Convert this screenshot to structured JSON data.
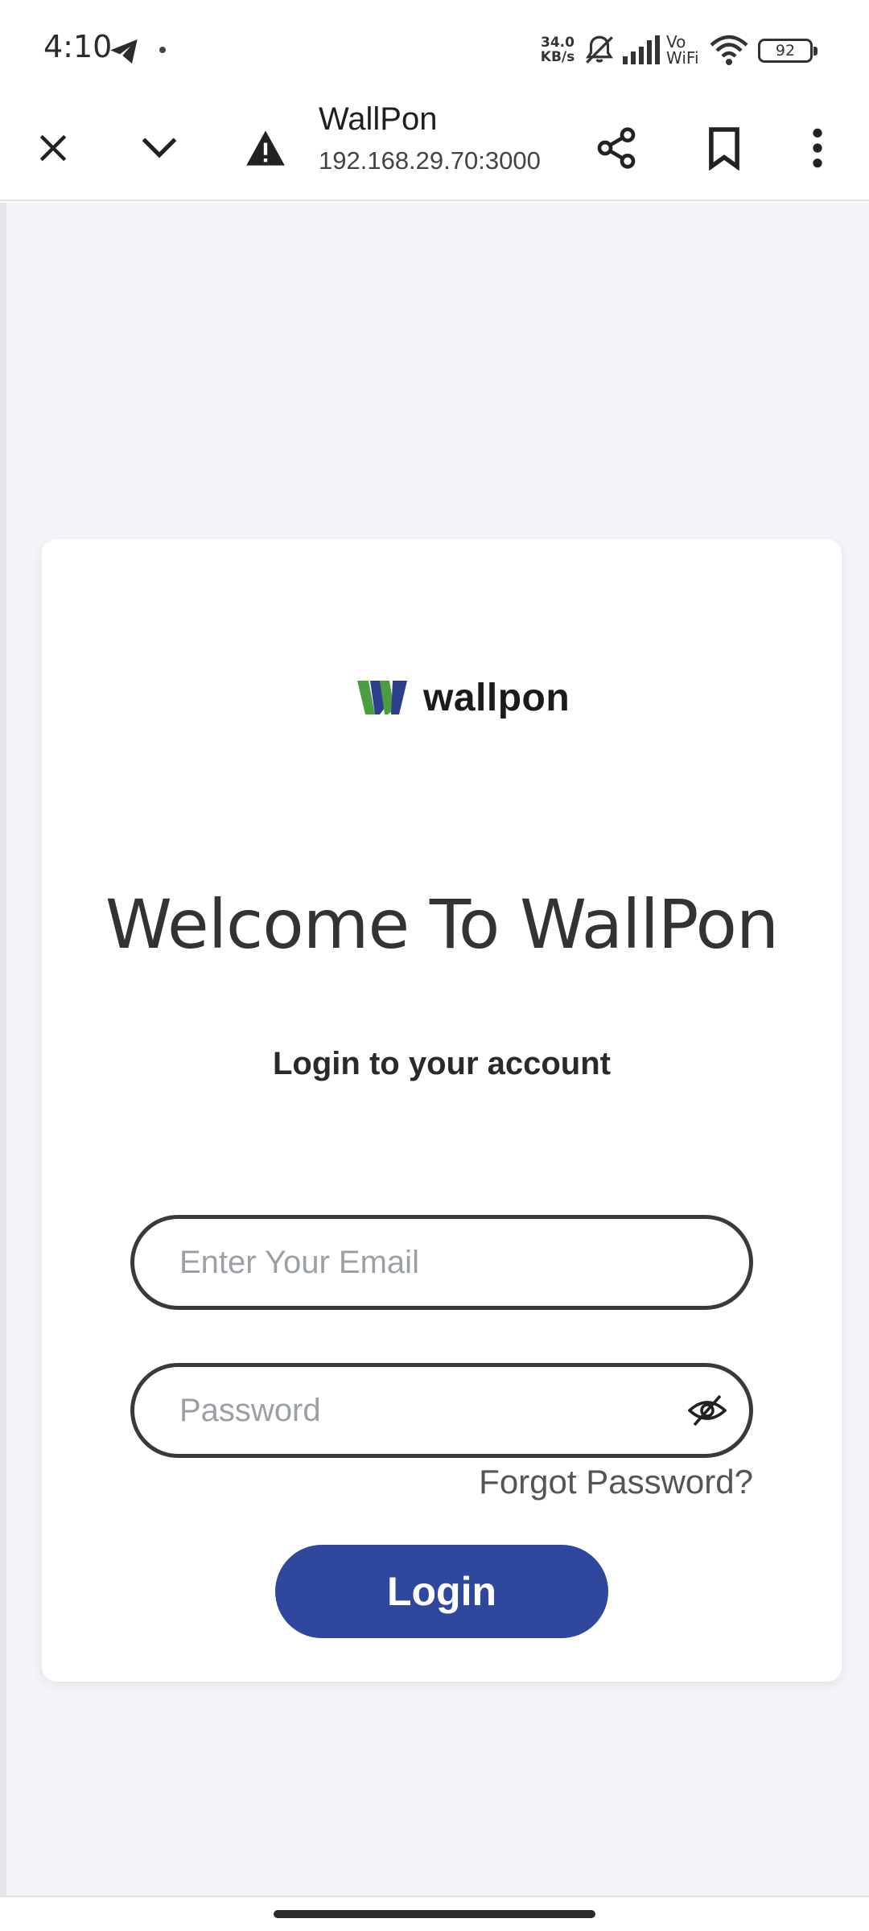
{
  "status_bar": {
    "time": "4:10",
    "net_speed_value": "34.0",
    "net_speed_unit": "KB/s",
    "vowifi_top": "Vo",
    "vowifi_bottom": "WiFi",
    "battery": "92",
    "icons": [
      "telegram-icon",
      "mute-icon",
      "signal-icon",
      "wifi-icon",
      "battery-icon"
    ]
  },
  "browser": {
    "title": "WallPon",
    "url": "192.168.29.70:3000",
    "icons": [
      "close-icon",
      "chevron-down-icon",
      "warning-icon",
      "share-icon",
      "bookmark-icon",
      "more-vert-icon"
    ]
  },
  "login_card": {
    "logo_text": "wallpon",
    "welcome": "Welcome To WallPon",
    "subtitle": "Login to your account",
    "email_placeholder": "Enter Your Email",
    "password_placeholder": "Password",
    "forgot_password": "Forgot Password?",
    "login_button": "Login"
  },
  "colors": {
    "brand_blue": "#2f479c",
    "logo_green": "#4b9e3f",
    "logo_navy": "#2c3f8f",
    "page_bg": "#f5f5f9"
  }
}
